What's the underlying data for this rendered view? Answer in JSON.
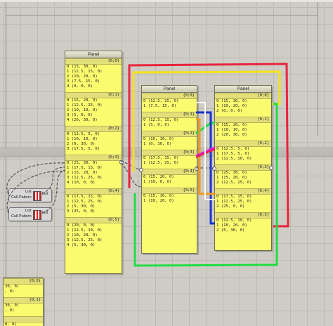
{
  "panels": {
    "a": {
      "title": "Panel",
      "branches": [
        {
          "path": "{0;0}",
          "items": [
            "0 (15, 30, 0)",
            "1 (12.5, 15, 0)",
            "2 (10, 20, 0)",
            "3 (7.5, 15, 0)",
            "4 (0, 0, 0)"
          ]
        },
        {
          "path": "{0;1}",
          "items": [
            "0 (15, 20, 0)",
            "1 (12.5, 25, 0)",
            "2 (10, 10, 0)",
            "3 (5, 0, 0)",
            "4 (20, 30, 0)"
          ]
        },
        {
          "path": "{0;2}",
          "items": [
            "0 (12.5, 5, 0)",
            "1 (10, 10, 0)",
            "2 (0, 30, 0)",
            "3 (17.5, 5, 0)"
          ]
        },
        {
          "path": "{0;3}",
          "items": [
            "0 (25, 30, 0)",
            "1 (17.5, 15, 0)",
            "2 (15, 20, 0)",
            "3 (12.5, 25, 0)",
            "4 (10, 0, 0)"
          ]
        },
        {
          "path": "{0;4}",
          "items": [
            "0 (17.5, 15, 0)",
            "1 (12.5, 25, 0)",
            "2 (5, 30, 0)",
            "3 (25, 0, 0)"
          ]
        },
        {
          "path": "{0;5}",
          "items": [
            "0 (20, 0, 0)",
            "1 (12.5, 10, 0)",
            "2 (10, 20, 0)",
            "3 (12.5, 25, 0)",
            "4 (5, 30, 0)"
          ]
        }
      ]
    },
    "b": {
      "title": "Panel",
      "branches": [
        {
          "path": "{0;0}",
          "items": [
            "0 (12.5, 25, 0)",
            "1 (7.5, 15, 0)"
          ]
        },
        {
          "path": "{0;1}",
          "items": [
            "0 (12.5, 15, 0)",
            "1 (5, 0, 0)"
          ]
        },
        {
          "path": "{0;2}",
          "items": [
            "0 (10, 10, 0)",
            "1 (0, 30, 0)"
          ]
        },
        {
          "path": "{0;3}",
          "items": [
            "0 (17.5, 15, 0)",
            "1 (12.5, 25, 0)"
          ]
        },
        {
          "path": "{0;4}",
          "items": [
            "0 (15, 20, 0)",
            "1 (10, 0, 0)"
          ]
        },
        {
          "path": "{0;5}",
          "items": [
            "0 (15, 10, 0)",
            "1 (10, 20, 0)"
          ]
        }
      ]
    },
    "c": {
      "title": "Panel",
      "branches": [
        {
          "path": "{0;0}",
          "items": [
            "0 (15, 30, 0)",
            "1 (10, 20, 0)",
            "2 (0, 0, 0)"
          ]
        },
        {
          "path": "{0;1}",
          "items": [
            "0 (15, 20, 0)",
            "1 (10, 10, 0)",
            "2 (20, 30, 0)"
          ]
        },
        {
          "path": "{0;2}",
          "items": [
            "0 (12.5, 5, 0)",
            "1 (17.5, 5, 0)",
            "2 (12.5, 10, 0)"
          ]
        },
        {
          "path": "{0;3}",
          "items": [
            "0 (25, 30, 0)",
            "1 (15, 20, 0)",
            "2 (12.5, 25, 0)"
          ]
        },
        {
          "path": "{0;4}",
          "items": [
            "0 (17.5, 15, 0)",
            "1 (12.5, 25, 0)",
            "2 (25, 0, 0)"
          ]
        },
        {
          "path": "{0;5}",
          "items": [
            "0 (12.5, 10, 0)",
            "1 (10, 20, 0)",
            "2 (5, 30, 0)"
          ]
        }
      ]
    },
    "d": {
      "branches": [
        {
          "path": "{0;0}",
          "items": [
            "30, 0)",
            ", 0)"
          ]
        },
        {
          "path": "{0;1}",
          "items": [
            "30, 0)",
            ", 0)"
          ]
        },
        {
          "path": "",
          "items": [
            "0, 0)"
          ]
        }
      ]
    }
  },
  "cull_nodes": [
    {
      "input_list": "List",
      "input_pattern": "Cull Pattern",
      "output": "List"
    },
    {
      "input_list": "List",
      "input_pattern": "Cull Pattern",
      "output": "List"
    }
  ],
  "wire_colors": {
    "red": "#e8243c",
    "yellow": "#f2e21a",
    "green": "#22dd44",
    "blue": "#1a33cc",
    "orange": "#f39a1a",
    "magenta": "#e018c8",
    "white": "#ffffff",
    "data": "#555555"
  }
}
